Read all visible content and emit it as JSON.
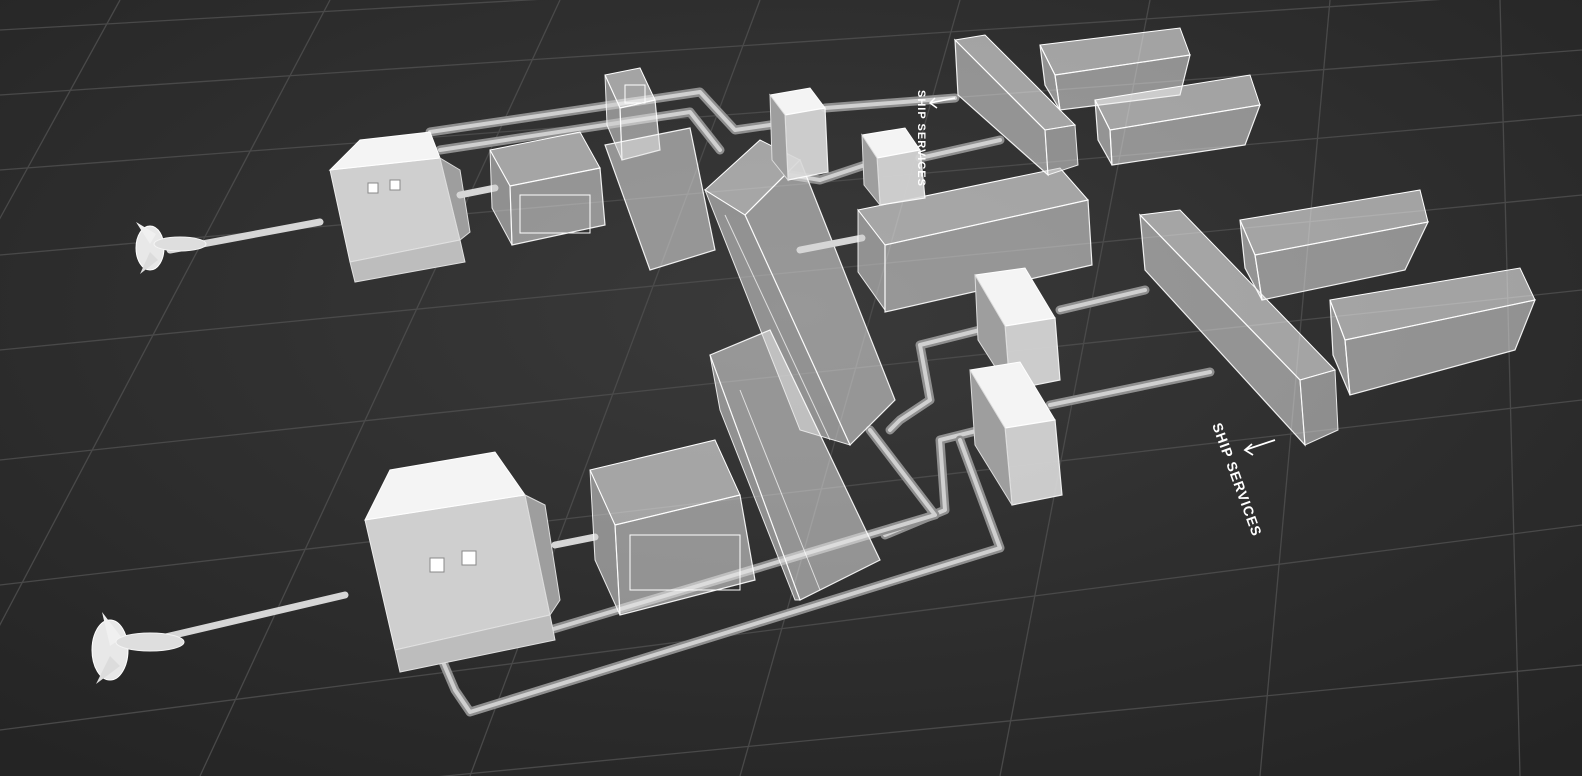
{
  "labels": {
    "ship_services_upper": "SHIP SERVICES",
    "ship_services_lower": "SHIP SERVICES"
  },
  "colors": {
    "background": "#2f2f2f",
    "grid_line": "#4a4a4a",
    "equipment": "#e6e6e6",
    "cable": "#9a9a9a"
  },
  "icons": {
    "arrow": "arrow-down-left-icon",
    "propeller": "propeller-icon"
  }
}
